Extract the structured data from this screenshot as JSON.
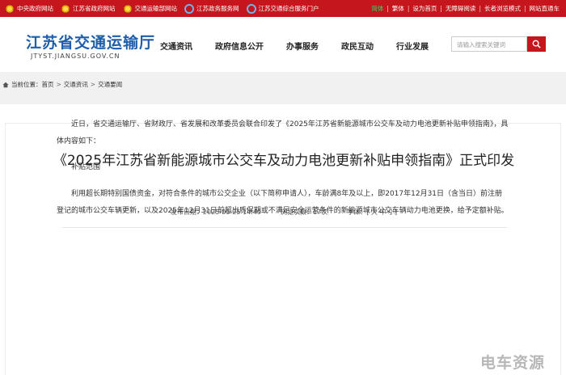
{
  "topbar": {
    "links": [
      "中央政府网站",
      "江苏省政府网站",
      "交通运输部网站",
      "江苏政务服务网",
      "江苏交通综合服务门户"
    ],
    "right": [
      "简体",
      "繁体",
      "设为首页",
      "无障碍阅读",
      "长者浏览模式",
      "网站直通车"
    ]
  },
  "header": {
    "title": "江苏省交通运输厅",
    "domain": "JTYST.JIANGSU.GOV.CN",
    "nav": [
      "交通资讯",
      "政府信息公开",
      "办事服务",
      "政民互动",
      "行业发展"
    ],
    "search_placeholder": "请输入搜索关键词"
  },
  "breadcrumb": {
    "label": "当前位置：",
    "items": [
      "首页",
      "交通资讯",
      "交通要闻"
    ]
  },
  "article": {
    "title": "《2025年江苏省新能源城市公交车及动力电池更新补贴申领指南》正式印发",
    "publish_label": "发布日期：",
    "publish_date": "2025-03-25 14:49",
    "views_label": "浏览次数：",
    "views": "17次",
    "font_label": "字体：",
    "font_options": "[ 大 中 小]",
    "paragraphs": [
      "近日，省交通运输厅、省财政厅、省发展和改革委员会联合印发了《2025年江苏省新能源城市公交车及动力电池更新补贴申领指南》，具体内容如下：",
      "补贴范围",
      "利用超长期特别国债资金，对符合条件的城市公交企业（以下简称申请人），车龄满8年及以上，即2017年12月31日（含当日）前注册登记的城市公交车辆更新，以及2025年12月31日前超出质保期或不满足安全运营条件的新能源城市公交车辆动力电池更换，给予定额补贴。"
    ]
  },
  "watermark": "电车资源",
  "colors": {
    "accent": "#c4161c",
    "brand_blue": "#1f5eab"
  }
}
